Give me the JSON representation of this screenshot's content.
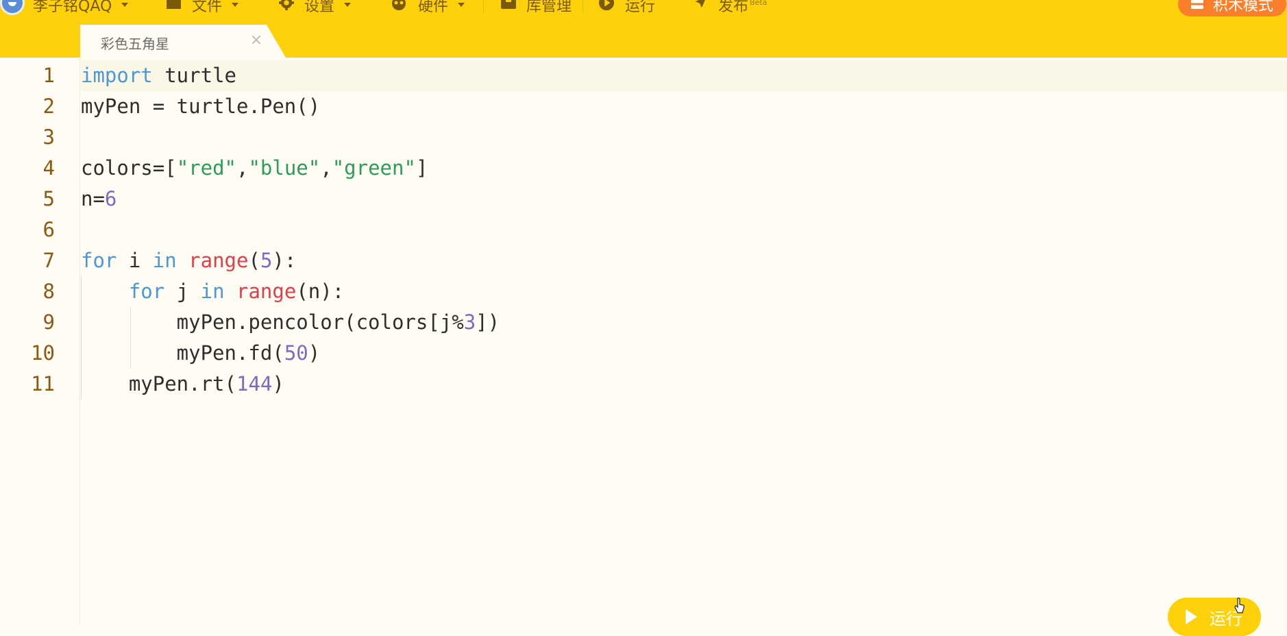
{
  "menubar": {
    "user_label": "李子铭QAQ",
    "file_label": "文件",
    "settings_label": "设置",
    "hardware_label": "硬件",
    "library_label": "库管理",
    "run_label": "运行",
    "publish_label": "发布",
    "publish_badge": "Beta",
    "block_mode_label": "积木模式"
  },
  "tab": {
    "title": "彩色五角星",
    "close": "×"
  },
  "editor": {
    "line_numbers": [
      "1",
      "2",
      "3",
      "4",
      "5",
      "6",
      "7",
      "8",
      "9",
      "10",
      "11"
    ],
    "active_line": 1,
    "lines": [
      [
        {
          "t": "import",
          "c": "kw"
        },
        {
          "t": " turtle"
        }
      ],
      [
        {
          "t": "myPen = turtle.Pen()"
        }
      ],
      [],
      [
        {
          "t": "colors=["
        },
        {
          "t": "\"red\"",
          "c": "str"
        },
        {
          "t": ","
        },
        {
          "t": "\"blue\"",
          "c": "str"
        },
        {
          "t": ","
        },
        {
          "t": "\"green\"",
          "c": "str"
        },
        {
          "t": "]"
        }
      ],
      [
        {
          "t": "n="
        },
        {
          "t": "6",
          "c": "num"
        }
      ],
      [],
      [
        {
          "t": "for",
          "c": "kw"
        },
        {
          "t": " i "
        },
        {
          "t": "in",
          "c": "kw"
        },
        {
          "t": " "
        },
        {
          "t": "range",
          "c": "bi"
        },
        {
          "t": "("
        },
        {
          "t": "5",
          "c": "num"
        },
        {
          "t": "):"
        }
      ],
      [
        {
          "t": "    "
        },
        {
          "t": "for",
          "c": "kw"
        },
        {
          "t": " j "
        },
        {
          "t": "in",
          "c": "kw"
        },
        {
          "t": " "
        },
        {
          "t": "range",
          "c": "bi"
        },
        {
          "t": "(n):"
        }
      ],
      [
        {
          "t": "        myPen.pencolor(colors[j%"
        },
        {
          "t": "3",
          "c": "num"
        },
        {
          "t": "])"
        }
      ],
      [
        {
          "t": "        myPen.fd("
        },
        {
          "t": "50",
          "c": "num"
        },
        {
          "t": ")"
        }
      ],
      [
        {
          "t": "    myPen.rt("
        },
        {
          "t": "144",
          "c": "num"
        },
        {
          "t": ")"
        }
      ]
    ]
  },
  "run_button": {
    "label": "运行"
  },
  "colors": {
    "toolbar": "#FFD10A",
    "editor_bg": "#FFFDF3",
    "line_number": "#8A5A14",
    "keyword": "#4A98DB",
    "string": "#2A9D58",
    "number": "#7B6BC3",
    "builtin": "#E23E4A",
    "block_mode_button": "#F97F2A"
  }
}
